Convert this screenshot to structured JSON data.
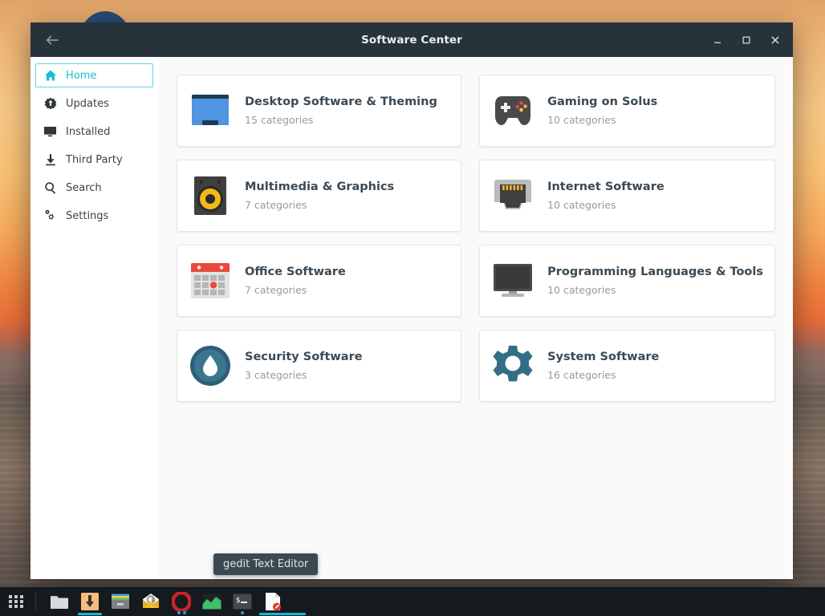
{
  "window": {
    "title": "Software Center",
    "back_icon": "back-arrow-icon",
    "controls": {
      "minimize": "—",
      "maximize": "□",
      "close": "✕"
    }
  },
  "sidebar": {
    "items": [
      {
        "label": "Home",
        "icon": "home-icon",
        "active": true
      },
      {
        "label": "Updates",
        "icon": "updates-icon",
        "active": false
      },
      {
        "label": "Installed",
        "icon": "installed-icon",
        "active": false
      },
      {
        "label": "Third Party",
        "icon": "download-icon",
        "active": false
      },
      {
        "label": "Search",
        "icon": "search-icon",
        "active": false
      },
      {
        "label": "Settings",
        "icon": "settings-icon",
        "active": false
      }
    ]
  },
  "main": {
    "cards": [
      {
        "title": "Desktop Software & Theming",
        "subtitle": "15 categories",
        "icon": "desktop-window-icon"
      },
      {
        "title": "Gaming on Solus",
        "subtitle": "10 categories",
        "icon": "gamepad-icon"
      },
      {
        "title": "Multimedia & Graphics",
        "subtitle": "7 categories",
        "icon": "speaker-icon"
      },
      {
        "title": "Internet Software",
        "subtitle": "10 categories",
        "icon": "ethernet-port-icon"
      },
      {
        "title": "Office Software",
        "subtitle": "7 categories",
        "icon": "calendar-icon"
      },
      {
        "title": "Programming Languages & Tools",
        "subtitle": "10 categories",
        "icon": "monitor-icon"
      },
      {
        "title": "Security Software",
        "subtitle": "3 categories",
        "icon": "security-droplet-icon"
      },
      {
        "title": "System Software",
        "subtitle": "16 categories",
        "icon": "gear-icon"
      }
    ]
  },
  "tooltip": {
    "text": "gedit Text Editor"
  },
  "taskbar": {
    "app_grid": "app-grid-icon",
    "items": [
      {
        "name": "files-manager",
        "icon": "folder-icon",
        "active": false
      },
      {
        "name": "downloader",
        "icon": "download-icon",
        "active": true
      },
      {
        "name": "archive-manager",
        "icon": "archive-icon",
        "active": false
      },
      {
        "name": "mail-client",
        "icon": "envelope-icon",
        "active": false
      },
      {
        "name": "opera-browser",
        "icon": "opera-icon",
        "active": false
      },
      {
        "name": "graphics-app",
        "icon": "chart-icon",
        "active": false
      },
      {
        "name": "terminal",
        "icon": "terminal-icon",
        "active": false
      },
      {
        "name": "gedit",
        "icon": "text-editor-icon",
        "active": true
      }
    ]
  },
  "colors": {
    "accent": "#19bcd6",
    "titlebar": "#26333b",
    "taskbar": "#151a1e",
    "card_title": "#3b4a55",
    "card_sub": "#9a9a9a",
    "teal_icon": "#336e87"
  }
}
